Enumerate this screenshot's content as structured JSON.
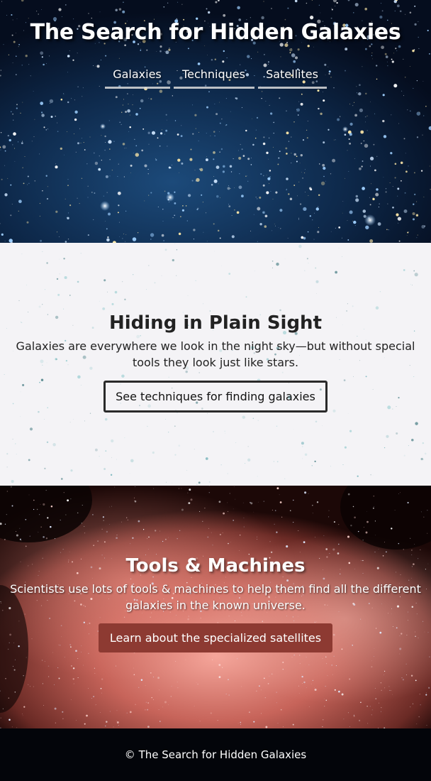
{
  "header": {
    "title": "The Search for Hidden Galaxies",
    "nav": [
      {
        "label": "Galaxies"
      },
      {
        "label": "Techniques"
      },
      {
        "label": "Satellites"
      }
    ]
  },
  "plain_sight": {
    "heading": "Hiding in Plain Sight",
    "text": "Galaxies are everywhere we look in the night sky—but without special tools they look just like stars.",
    "button_label": "See techniques for finding galaxies"
  },
  "tools": {
    "heading": "Tools & Machines",
    "text": "Scientists use lots of tools & machines to help them find all the different galaxies in the known universe.",
    "button_label": "Learn about the specialized satellites"
  },
  "footer": {
    "copyright": "© The Search for Hidden Galaxies"
  },
  "colors": {
    "hero_bg": "#07152c",
    "plain_bg": "#f4f3f6",
    "tools_bg": "#2a0d0c",
    "accent_button": "#8d3a32",
    "footer_bg": "#03050a"
  }
}
